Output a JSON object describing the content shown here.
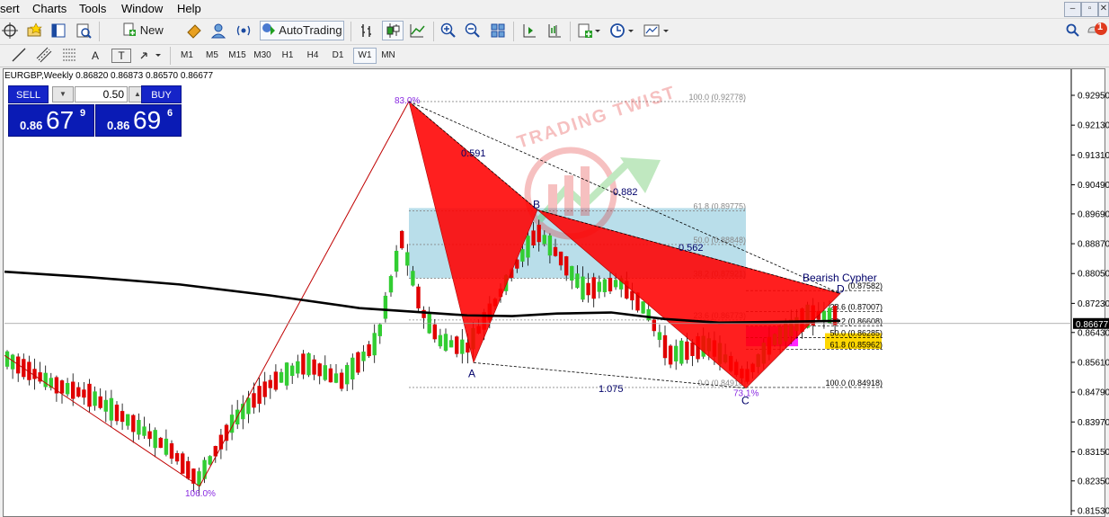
{
  "menu": [
    "sert",
    "Charts",
    "Tools",
    "Window",
    "Help"
  ],
  "window_controls": [
    "–",
    "▫",
    "✕"
  ],
  "toolbar": {
    "new_order": "New Order",
    "autotrading": "AutoTrading",
    "draw_labels": [
      "A",
      "T"
    ]
  },
  "timeframes": [
    "M1",
    "M5",
    "M15",
    "M30",
    "H1",
    "H4",
    "D1",
    "W1",
    "MN"
  ],
  "active_timeframe": "W1",
  "notification_count": "1",
  "chart": {
    "title": "EURGBP,Weekly  0.86820 0.86873 0.86570 0.86677",
    "price_label": "0.86677"
  },
  "trade_panel": {
    "sell_label": "SELL",
    "buy_label": "BUY",
    "lot_value": "0.50",
    "sell_price": {
      "small": "0.86",
      "big": "67",
      "sup": "9"
    },
    "buy_price": {
      "small": "0.86",
      "big": "69",
      "sup": "6"
    }
  },
  "chart_data": {
    "type": "candlestick",
    "symbol": "EURGBP",
    "timeframe": "Weekly",
    "ohlc_header": [
      0.8682,
      0.86873,
      0.8657,
      0.86677
    ],
    "ylim": [
      0.8153,
      0.9295
    ],
    "y_ticks": [
      "0.92950",
      "0.92130",
      "0.91310",
      "0.90490",
      "0.89690",
      "0.88870",
      "0.88050",
      "0.87230",
      "0.86430",
      "0.85610",
      "0.84790",
      "0.83970",
      "0.83150",
      "0.82350",
      "0.81530"
    ],
    "pattern_points": {
      "X": {
        "label": "X",
        "pct": "83.0%"
      },
      "A": {
        "label": "A"
      },
      "B": {
        "label": "B"
      },
      "C": {
        "label": "C",
        "pct": "73.1%"
      },
      "D": {
        "label": "D"
      },
      "start": {
        "pct": "106.0%"
      }
    },
    "ratios": [
      "0.591",
      "0.882",
      "0.562",
      "1.075"
    ],
    "pattern_name": "Bearish Cypher",
    "fib_upper": [
      "100.0 (0.92778)",
      "61.8 (0.89775)",
      "50.0 (0.88848)",
      "38.2 (0.87921)",
      "23.6 (0.86773)",
      "0.0 (0.84918)"
    ],
    "fib_lower": [
      "(0.87582)",
      "23.6 (0.87007)",
      "38.2 (0.86608)",
      "50.0 (0.86285)",
      "61.8 (0.85962)",
      "100.0 (0.84918)"
    ],
    "watermark": "TRADING TWIST",
    "colors": {
      "bull": "#32cd32",
      "bear": "#e00000",
      "pattern": "#ff0000",
      "ma": "#000000",
      "fib_box": "#add8e6",
      "zone_yellow": "#ffd700",
      "zone_magenta": "#ff00ff"
    }
  }
}
